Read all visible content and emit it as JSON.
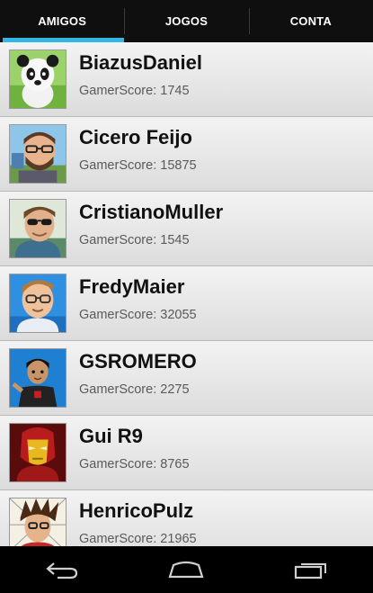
{
  "tabs": [
    {
      "label": "AMIGOS",
      "active": true
    },
    {
      "label": "JOGOS",
      "active": false
    },
    {
      "label": "CONTA",
      "active": false
    }
  ],
  "colors": {
    "accent": "#33b5e5",
    "tabbar": "#0f0f0f",
    "list_bg": "#e3e3e3"
  },
  "friends": [
    {
      "name": "BiazusDaniel",
      "score": "GamerScore: 1745",
      "avatar": "panda-avatar"
    },
    {
      "name": "Cicero Feijo",
      "score": "GamerScore: 15875",
      "avatar": "bearded-glasses-avatar"
    },
    {
      "name": "CristianoMuller",
      "score": "GamerScore: 1545",
      "avatar": "sunglasses-avatar"
    },
    {
      "name": "FredyMaier",
      "score": "GamerScore: 32055",
      "avatar": "glasses-avatar"
    },
    {
      "name": "GSROMERO",
      "score": "GamerScore: 2275",
      "avatar": "dark-hair-avatar"
    },
    {
      "name": "Gui R9",
      "score": "GamerScore: 8765",
      "avatar": "iron-man-avatar"
    },
    {
      "name": "HenricoPulz",
      "score": "GamerScore: 21965",
      "avatar": "spiky-hair-avatar"
    }
  ],
  "navbar": {
    "back": "back-icon",
    "home": "home-icon",
    "recents": "recent-apps-icon"
  }
}
